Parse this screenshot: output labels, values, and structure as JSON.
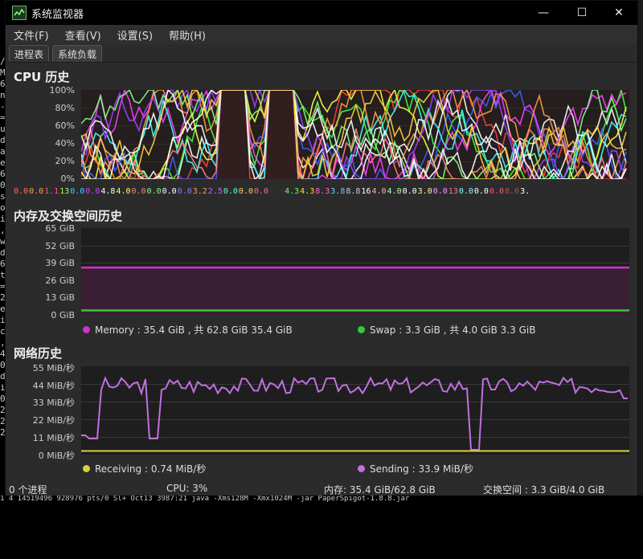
{
  "window": {
    "title": "系统监视器",
    "controls": {
      "minimize": "—",
      "maximize": "☐",
      "close": "✕"
    }
  },
  "menu": [
    "文件(F)",
    "查看(V)",
    "设置(S)",
    "帮助(H)"
  ],
  "tabs": [
    {
      "label": "进程表",
      "active": false
    },
    {
      "label": "系统负载",
      "active": true
    }
  ],
  "cpu": {
    "title": "CPU 历史",
    "y_labels": [
      "100%",
      "80%",
      "60%",
      "40%",
      "20%",
      "0%"
    ],
    "core_values": [
      {
        "v": "0.0",
        "c": "#ff6b6b"
      },
      {
        "v": "0.0",
        "c": "#ffa040"
      },
      {
        "v": "1.1",
        "c": "#ff4aa0"
      },
      {
        "v": "13",
        "c": "#a0ff40"
      },
      {
        "v": "0.0",
        "c": "#40d0ff"
      },
      {
        "v": "0.0",
        "c": "#d040ff"
      },
      {
        "v": "4.8",
        "c": "#ffffff"
      },
      {
        "v": "4.0",
        "c": "#ffff60"
      },
      {
        "v": "0.0",
        "c": "#ff8080"
      },
      {
        "v": "0.0",
        "c": "#80ff80"
      },
      {
        "v": "0.0",
        "c": "#ffffff"
      },
      {
        "v": "0.0",
        "c": "#8080ff"
      },
      {
        "v": "3.2",
        "c": "#ff9966"
      },
      {
        "v": "2.5",
        "c": "#cc66ff"
      },
      {
        "v": "0.0",
        "c": "#66ffcc"
      },
      {
        "v": "0.0",
        "c": "#ffcc66"
      },
      {
        "v": "0.0",
        "c": "#ff6699"
      },
      {
        "v": "0.0",
        "c": "#333333"
      },
      {
        "v": "4.3",
        "c": "#66ff66"
      },
      {
        "v": "4.3",
        "c": "#ffdd00"
      },
      {
        "v": "8.3",
        "c": "#ff66cc"
      },
      {
        "v": "3.8",
        "c": "#66ccff"
      },
      {
        "v": "8.8",
        "c": "#cccccc"
      },
      {
        "v": "16",
        "c": "#ffffff"
      },
      {
        "v": "4.0",
        "c": "#ffaaaa"
      },
      {
        "v": "4.0",
        "c": "#aaffaa"
      },
      {
        "v": "0.0",
        "c": "#ffffff"
      },
      {
        "v": "3.0",
        "c": "#ffff99"
      },
      {
        "v": "0.0",
        "c": "#ff99ff"
      },
      {
        "v": "13",
        "c": "#ff7777"
      },
      {
        "v": "0.0",
        "c": "#77ffff"
      },
      {
        "v": "0.0",
        "c": "#ffffff"
      },
      {
        "v": "0.0",
        "c": "#ff5577"
      },
      {
        "v": "8.0",
        "c": "#aa5555"
      },
      {
        "v": "3.",
        "c": "#ffffff"
      }
    ]
  },
  "memory": {
    "title": "内存及交换空间历史",
    "y_labels": [
      "65 GiB",
      "52 GiB",
      "39 GiB",
      "26 GiB",
      "13 GiB",
      "0 GiB"
    ],
    "memory_legend": "Memory : 35.4 GiB , 共 62.8 GiB 35.4 GiB",
    "swap_legend": "Swap : 3.3 GiB , 共 4.0 GiB 3.3 GiB",
    "memory_color": "#cc33cc",
    "swap_color": "#33cc33",
    "memory_used": 35.4,
    "memory_total": 62.8,
    "swap_used": 3.3,
    "swap_total": 4.0
  },
  "network": {
    "title": "网络历史",
    "y_labels": [
      "55 MiB/秒",
      "44 MiB/秒",
      "33 MiB/秒",
      "22 MiB/秒",
      "11 MiB/秒",
      "0 MiB/秒"
    ],
    "receiving_legend": "Receiving : 0.74 MiB/秒",
    "sending_legend": "Sending : 33.9 MiB/秒",
    "receiving_color": "#d8d040",
    "sending_color": "#c070e0"
  },
  "status": {
    "processes": "0 个进程",
    "cpu": "CPU: 3%",
    "memory": "内存: 35.4 GiB/62.8 GiB",
    "swap": "交换空间 : 3.3 GiB/4.0 GiB"
  },
  "terminal": {
    "bottom_line": "1 4 14519496 928976 pts/0 Sl+  Oct13 3987:21 java -Xms128M -Xmx1024M -jar PaperSpigot-1.8.8.jar",
    "left_chars": "/ M 6 n - = u d a e 6 0 s o i , w d 6 t = 2 e i c , 4 0 d i 0 2 2 2"
  }
}
